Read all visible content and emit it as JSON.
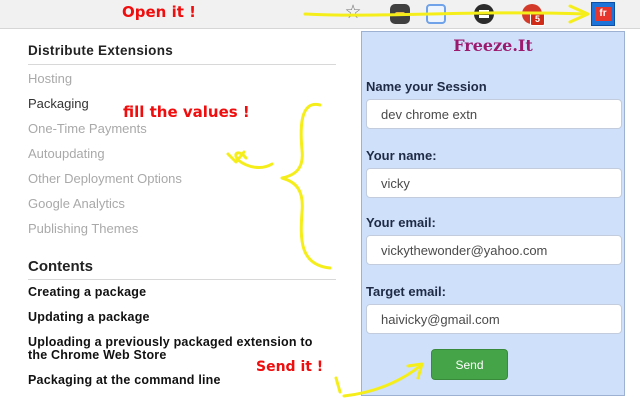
{
  "annotations": {
    "open_it": "Open it !",
    "fill_values": "fill the values !",
    "send_it": "Send it !"
  },
  "toolbar": {
    "icons": [
      "star-icon",
      "extension-icon",
      "extension-icon",
      "extension-icon",
      "extension-icon",
      "freeze-it-icon"
    ],
    "badge_count": "5",
    "freeze_icon_label": "fr"
  },
  "doc": {
    "section_title": "Distribute Extensions",
    "nav": [
      {
        "label": "Hosting"
      },
      {
        "label": "Packaging"
      },
      {
        "label": "One-Time Payments"
      },
      {
        "label": "Autoupdating"
      },
      {
        "label": "Other Deployment Options"
      },
      {
        "label": "Google Analytics"
      },
      {
        "label": "Publishing Themes"
      }
    ],
    "contents_title": "Contents",
    "toc": [
      {
        "label": "Creating a package"
      },
      {
        "label": "Updating a package"
      },
      {
        "label": "Uploading a previously packaged extension to the Chrome Web Store"
      },
      {
        "label": "Packaging at the command line"
      }
    ]
  },
  "popup": {
    "title": "Freeze.It",
    "session_label": "Name your Session",
    "session_value": "dev chrome extn",
    "name_label": "Your name:",
    "name_value": "vicky",
    "email_label": "Your email:",
    "email_value": "vickythewonder@yahoo.com",
    "target_label": "Target email:",
    "target_value": "haivicky@gmail.com",
    "send_label": "Send"
  },
  "colors": {
    "annotation_red": "#f00d0d",
    "annotation_yellow": "#f5ee1a",
    "popup_bg": "#cfe0fb",
    "popup_title": "#9b1a6e",
    "send_green": "#45a447"
  }
}
